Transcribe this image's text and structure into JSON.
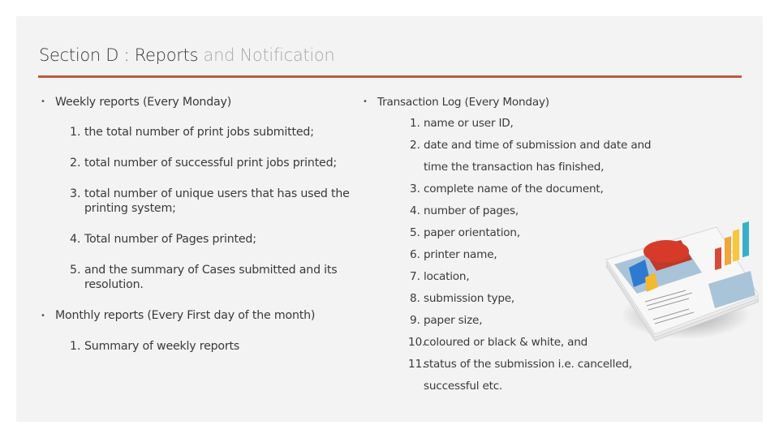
{
  "slide": {
    "title_main": "Section D : Reports",
    "title_light": " and Notification",
    "accent_color": "#b85c44"
  },
  "left": {
    "weekly": {
      "heading": "Weekly reports (Every Monday)",
      "items": [
        {
          "num": "1.",
          "text": "the total number of print jobs submitted;"
        },
        {
          "num": "2.",
          "text": "total number of successful print jobs printed;"
        },
        {
          "num": "3.",
          "text": "total number of unique users that has used the",
          "text2": "printing system;"
        },
        {
          "num": "4.",
          "text": "Total number of Pages printed;"
        },
        {
          "num": "5.",
          "text": "and the summary of Cases submitted and its",
          "text2": "resolution."
        }
      ]
    },
    "monthly": {
      "heading": "Monthly reports (Every First day of the month)",
      "items": [
        {
          "num": "1.",
          "text": "Summary of weekly reports"
        }
      ]
    }
  },
  "right": {
    "heading": "Transaction Log (Every Monday)",
    "items": [
      {
        "num": "1.",
        "text": "name or user ID,"
      },
      {
        "num": "2.",
        "text": "date and time of submission and date and",
        "text2": "time the transaction has finished,"
      },
      {
        "num": "3.",
        "text": "complete name of the document,"
      },
      {
        "num": "4.",
        "text": "number of pages,"
      },
      {
        "num": "5.",
        "text": "paper orientation,"
      },
      {
        "num": "6.",
        "text": "printer name,"
      },
      {
        "num": "7.",
        "text": "location,"
      },
      {
        "num": "8.",
        "text": "submission type,"
      },
      {
        "num": "9.",
        "text": "paper size,"
      },
      {
        "num": "10.",
        "text": "coloured or black & white, and"
      },
      {
        "num": "11.",
        "text": "status of the submission i.e. cancelled,",
        "text2": "successful etc."
      }
    ]
  },
  "image": {
    "icon": "report-documents-with-charts-icon"
  }
}
